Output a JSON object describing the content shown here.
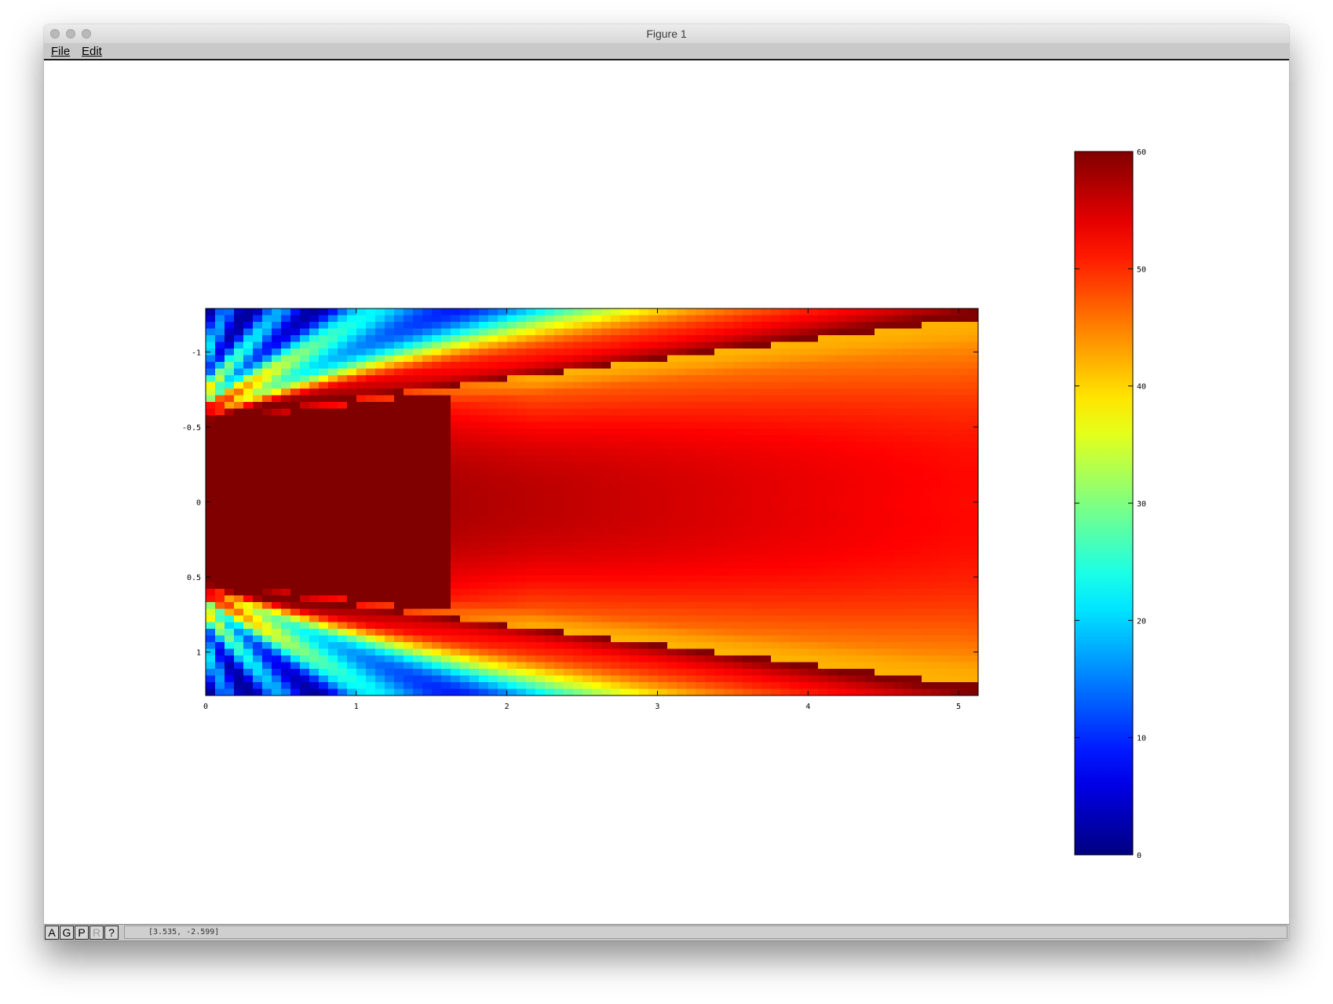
{
  "window": {
    "title": "Figure 1"
  },
  "menu": {
    "file": "File",
    "edit": "Edit"
  },
  "toolbar": {
    "buttons": [
      "A",
      "G",
      "P",
      "R",
      "?"
    ]
  },
  "status": {
    "coordinates": "[3.535, -2.599]"
  },
  "chart_data": {
    "type": "heatmap",
    "colormap": "jet",
    "title": "",
    "xlabel": "",
    "ylabel": "",
    "xlim": [
      0,
      5.13
    ],
    "ylim": [
      -1.29,
      1.29
    ],
    "y_reversed": true,
    "xticks": [
      0,
      1,
      2,
      3,
      4,
      5
    ],
    "yticks": [
      -1,
      -0.5,
      0,
      0.5,
      1
    ],
    "ytick_labels": [
      "-1",
      "-0.5",
      "0",
      "0.5",
      "1"
    ],
    "clim": [
      0,
      60
    ],
    "colorbar_ticks": [
      0,
      10,
      20,
      30,
      40,
      50,
      60
    ],
    "field_description_values": {
      "near_core_value": 60,
      "far_center_value": 52,
      "far_edge_value": 8
    },
    "colors": {
      "jet_stops": [
        "#000080",
        "#0000ff",
        "#00ffff",
        "#ffff00",
        "#ff0000",
        "#800000"
      ]
    }
  }
}
